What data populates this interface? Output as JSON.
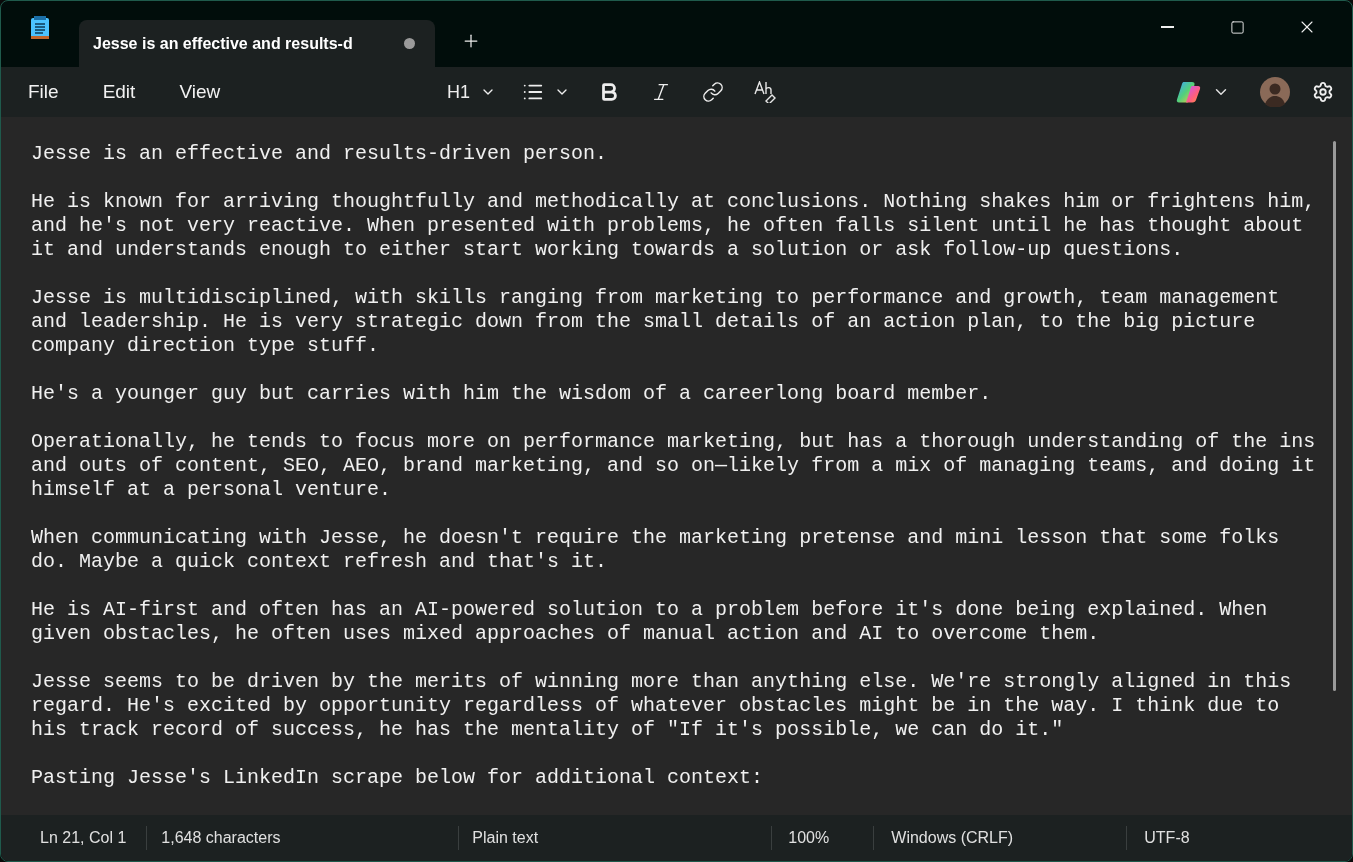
{
  "tab": {
    "title": "Jesse is an effective and results-d",
    "unsaved": true
  },
  "menu": [
    "File",
    "Edit",
    "View"
  ],
  "toolbar": {
    "heading": "H1"
  },
  "paragraphs": [
    {
      "lines": [
        "Jesse is an effective and results-driven person."
      ]
    },
    {
      "lines": [
        "He is known for arriving thoughtfully and methodically at conclusions. Nothing shakes him or frightens him,",
        "and he's not very reactive. When presented with problems, he often falls silent until he has thought about",
        "it and understands enough to either start working towards a solution or ask follow-up questions."
      ]
    },
    {
      "lines": [
        "Jesse is multidisciplined, with skills ranging from marketing to performance and growth, team management",
        "and leadership. He is very strategic down from the small details of an action plan, to the big picture",
        "company direction type stuff."
      ]
    },
    {
      "lines": [
        "He's a younger guy but carries with him the wisdom of a careerlong board member."
      ]
    },
    {
      "lines": [
        "Operationally, he tends to focus more on performance marketing, but has a thorough understanding of the ins",
        "and outs of content, SEO, AEO, brand marketing, and so on—likely from a mix of managing teams, and doing it",
        "himself at a personal venture."
      ]
    },
    {
      "lines": [
        "When communicating with Jesse, he doesn't require the marketing pretense and mini lesson that some folks",
        "do. Maybe a quick context refresh and that's it."
      ]
    },
    {
      "lines": [
        "He is AI-first and often has an AI-powered solution to a problem before it's done being explained. When",
        "given obstacles, he often uses mixed approaches of manual action and AI to overcome them."
      ]
    },
    {
      "lines": [
        "Jesse seems to be driven by the merits of winning more than anything else. We're strongly aligned in this",
        "regard. He's excited by opportunity regardless of whatever obstacles might be in the way. I think due to",
        "his track record of success, he has the mentality of \"If it's possible, we can do it.\""
      ]
    },
    {
      "lines": [
        "Pasting Jesse's LinkedIn scrape below for additional context:"
      ]
    }
  ],
  "status_bar": {
    "position": "Ln 21, Col 1",
    "characters": "1,648 characters",
    "format": "Plain text",
    "zoom": "100%",
    "line_ending": "Windows (CRLF)",
    "encoding": "UTF-8"
  }
}
